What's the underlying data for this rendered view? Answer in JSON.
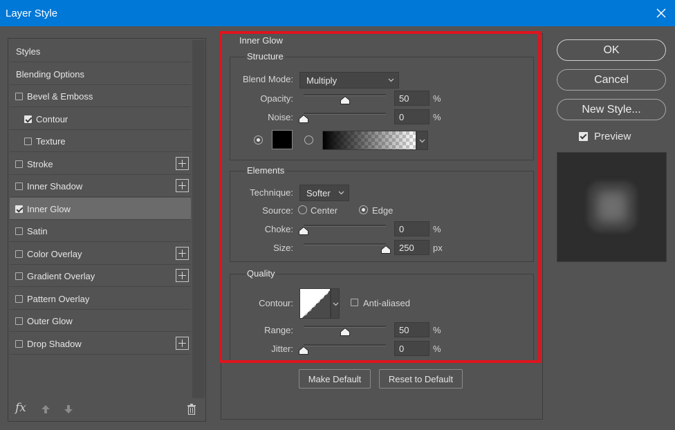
{
  "window": {
    "title": "Layer Style"
  },
  "styles_list": {
    "items": [
      {
        "label": "Styles",
        "checkbox": false,
        "checked": false,
        "indent": false,
        "plus": false,
        "selected": false
      },
      {
        "label": "Blending Options",
        "checkbox": false,
        "checked": false,
        "indent": false,
        "plus": false,
        "selected": false
      },
      {
        "label": "Bevel & Emboss",
        "checkbox": true,
        "checked": false,
        "indent": false,
        "plus": false,
        "selected": false
      },
      {
        "label": "Contour",
        "checkbox": true,
        "checked": true,
        "indent": true,
        "plus": false,
        "selected": false
      },
      {
        "label": "Texture",
        "checkbox": true,
        "checked": false,
        "indent": true,
        "plus": false,
        "selected": false
      },
      {
        "label": "Stroke",
        "checkbox": true,
        "checked": false,
        "indent": false,
        "plus": true,
        "selected": false
      },
      {
        "label": "Inner Shadow",
        "checkbox": true,
        "checked": false,
        "indent": false,
        "plus": true,
        "selected": false
      },
      {
        "label": "Inner Glow",
        "checkbox": true,
        "checked": true,
        "indent": false,
        "plus": false,
        "selected": true
      },
      {
        "label": "Satin",
        "checkbox": true,
        "checked": false,
        "indent": false,
        "plus": false,
        "selected": false
      },
      {
        "label": "Color Overlay",
        "checkbox": true,
        "checked": false,
        "indent": false,
        "plus": true,
        "selected": false
      },
      {
        "label": "Gradient Overlay",
        "checkbox": true,
        "checked": false,
        "indent": false,
        "plus": true,
        "selected": false
      },
      {
        "label": "Pattern Overlay",
        "checkbox": true,
        "checked": false,
        "indent": false,
        "plus": false,
        "selected": false
      },
      {
        "label": "Outer Glow",
        "checkbox": true,
        "checked": false,
        "indent": false,
        "plus": false,
        "selected": false
      },
      {
        "label": "Drop Shadow",
        "checkbox": true,
        "checked": false,
        "indent": false,
        "plus": true,
        "selected": false
      }
    ],
    "fx_label": "fx"
  },
  "inner_glow": {
    "title": "Inner Glow",
    "structure": {
      "title": "Structure",
      "blend_mode_label": "Blend Mode:",
      "blend_mode_value": "Multiply",
      "opacity_label": "Opacity:",
      "opacity_value": "50",
      "opacity_unit": "%",
      "opacity_fraction": 0.5,
      "noise_label": "Noise:",
      "noise_value": "0",
      "noise_unit": "%",
      "noise_fraction": 0.0,
      "color_radio_selected": true,
      "gradient_radio_selected": false,
      "swatch_color": "#000000"
    },
    "elements": {
      "title": "Elements",
      "technique_label": "Technique:",
      "technique_value": "Softer",
      "source_label": "Source:",
      "source_center_label": "Center",
      "source_edge_label": "Edge",
      "source_selected": "Edge",
      "choke_label": "Choke:",
      "choke_value": "0",
      "choke_unit": "%",
      "choke_fraction": 0.0,
      "size_label": "Size:",
      "size_value": "250",
      "size_unit": "px",
      "size_fraction": 1.0
    },
    "quality": {
      "title": "Quality",
      "contour_label": "Contour:",
      "anti_aliased_label": "Anti-aliased",
      "anti_aliased_checked": false,
      "range_label": "Range:",
      "range_value": "50",
      "range_unit": "%",
      "range_fraction": 0.5,
      "jitter_label": "Jitter:",
      "jitter_value": "0",
      "jitter_unit": "%",
      "jitter_fraction": 0.0
    },
    "make_default_label": "Make Default",
    "reset_default_label": "Reset to Default"
  },
  "actions": {
    "ok_label": "OK",
    "cancel_label": "Cancel",
    "new_style_label": "New Style...",
    "preview_label": "Preview",
    "preview_checked": true
  },
  "colors": {
    "titlebar": "#0078d7",
    "highlight_box": "#e0141e",
    "dialog_bg": "#535353"
  }
}
